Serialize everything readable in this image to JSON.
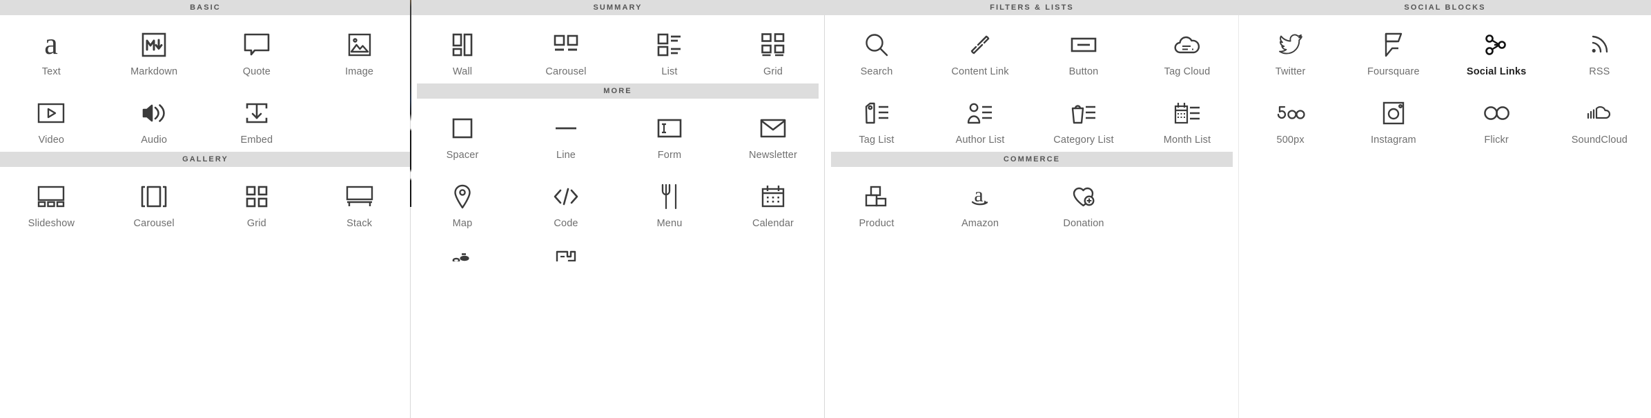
{
  "meta": {
    "header_bg": "#dddddd",
    "header_text_color": "#555555",
    "label_color": "#6f6f6f",
    "icon_color": "#3b3b3b",
    "active_color": "#1f1f1f",
    "page_bg": "#ffffff"
  },
  "columns": [
    {
      "id": "column-basic",
      "sections": [
        {
          "title": "BASIC",
          "blocks": [
            {
              "label": "Text",
              "icon": "text-a-icon"
            },
            {
              "label": "Markdown",
              "icon": "markdown-icon"
            },
            {
              "label": "Quote",
              "icon": "quote-bubble-icon"
            },
            {
              "label": "Image",
              "icon": "image-icon"
            },
            {
              "label": "Video",
              "icon": "video-play-icon"
            },
            {
              "label": "Audio",
              "icon": "audio-speaker-icon"
            },
            {
              "label": "Embed",
              "icon": "embed-download-icon"
            }
          ]
        },
        {
          "title": "GALLERY",
          "blocks": [
            {
              "label": "Slideshow",
              "icon": "slideshow-icon"
            },
            {
              "label": "Carousel",
              "icon": "gallery-carousel-icon"
            },
            {
              "label": "Grid",
              "icon": "gallery-grid-icon"
            },
            {
              "label": "Stack",
              "icon": "stack-icon"
            }
          ]
        }
      ]
    },
    {
      "id": "column-summary",
      "sections": [
        {
          "title": "SUMMARY",
          "blocks": [
            {
              "label": "Wall",
              "icon": "summary-wall-icon"
            },
            {
              "label": "Carousel",
              "icon": "summary-carousel-icon"
            },
            {
              "label": "List",
              "icon": "summary-list-icon"
            },
            {
              "label": "Grid",
              "icon": "summary-grid-icon"
            }
          ]
        },
        {
          "title": "MORE",
          "blocks": [
            {
              "label": "Spacer",
              "icon": "spacer-icon"
            },
            {
              "label": "Line",
              "icon": "line-icon"
            },
            {
              "label": "Form",
              "icon": "form-icon"
            },
            {
              "label": "Newsletter",
              "icon": "newsletter-envelope-icon"
            },
            {
              "label": "Map",
              "icon": "map-pin-icon"
            },
            {
              "label": "Code",
              "icon": "code-brackets-icon"
            },
            {
              "label": "Menu",
              "icon": "menu-fork-knife-icon"
            },
            {
              "label": "Calendar",
              "icon": "calendar-icon"
            },
            {
              "label": "",
              "icon": "opentable-icon"
            },
            {
              "label": "",
              "icon": "chart-bar-icon"
            }
          ]
        }
      ]
    },
    {
      "id": "column-filters",
      "sections": [
        {
          "title": "FILTERS & LISTS",
          "blocks": [
            {
              "label": "Search",
              "icon": "search-icon"
            },
            {
              "label": "Content Link",
              "icon": "content-link-icon"
            },
            {
              "label": "Button",
              "icon": "button-icon"
            },
            {
              "label": "Tag Cloud",
              "icon": "tag-cloud-icon"
            },
            {
              "label": "Tag List",
              "icon": "tag-list-icon"
            },
            {
              "label": "Author List",
              "icon": "author-list-icon"
            },
            {
              "label": "Category List",
              "icon": "category-list-icon"
            },
            {
              "label": "Month List",
              "icon": "month-list-icon"
            }
          ]
        },
        {
          "title": "COMMERCE",
          "blocks": [
            {
              "label": "Product",
              "icon": "product-boxes-icon"
            },
            {
              "label": "Amazon",
              "icon": "amazon-icon"
            },
            {
              "label": "Donation",
              "icon": "donation-heart-icon"
            }
          ]
        }
      ]
    },
    {
      "id": "column-social",
      "sections": [
        {
          "title": "SOCIAL BLOCKS",
          "blocks": [
            {
              "label": "Twitter",
              "icon": "twitter-icon"
            },
            {
              "label": "Foursquare",
              "icon": "foursquare-icon"
            },
            {
              "label": "Social Links",
              "icon": "social-links-icon",
              "active": true
            },
            {
              "label": "RSS",
              "icon": "rss-icon"
            },
            {
              "label": "500px",
              "icon": "fivehundredpx-icon"
            },
            {
              "label": "Instagram",
              "icon": "instagram-icon"
            },
            {
              "label": "Flickr",
              "icon": "flickr-icon"
            },
            {
              "label": "SoundCloud",
              "icon": "soundcloud-icon"
            }
          ]
        }
      ]
    }
  ]
}
